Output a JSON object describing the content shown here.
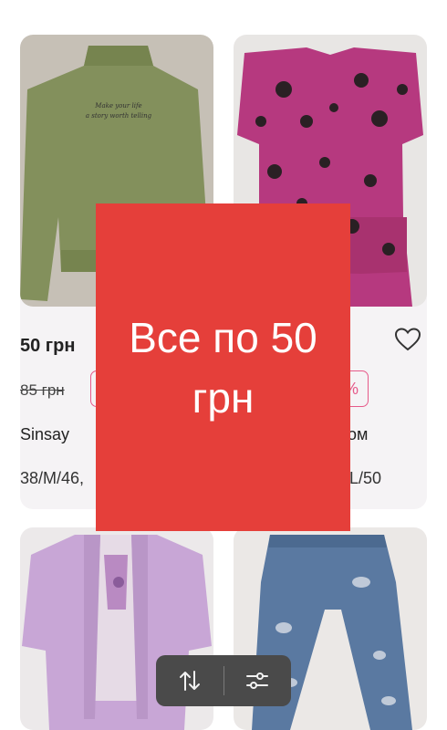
{
  "products": [
    {
      "price": "50 грн",
      "old_price": "85 грн",
      "discount": "",
      "brand": "Sinsay",
      "sizes": "38/M/46,",
      "colors": {
        "photo_bg": "#c6c0b6",
        "garment": "#83905c"
      }
    },
    {
      "price": "",
      "old_price": "",
      "discount": "%",
      "brand": "ом",
      "sizes": "L/50",
      "colors": {
        "photo_bg": "#e8e6e4",
        "garment": "#b6397f"
      }
    },
    {
      "colors": {
        "photo_bg": "#ece9ea",
        "garment": "#c8a6d6"
      }
    },
    {
      "colors": {
        "photo_bg": "#ebe8e6",
        "garment": "#5a79a1"
      }
    }
  ],
  "banner": {
    "line1": "Все по 50",
    "line2": "грн",
    "color": "#e53f3a"
  },
  "toolbar": {
    "sort_icon": "sort-icon",
    "filter_icon": "filter-icon"
  },
  "icons": {
    "favorite": "heart-icon"
  }
}
